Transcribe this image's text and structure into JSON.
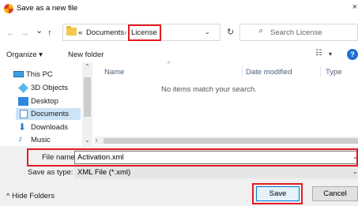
{
  "window": {
    "title": "Save as a new file",
    "close_glyph": "×"
  },
  "nav_buttons": {
    "back": "←",
    "forward": "→",
    "history": "⌄",
    "up": "↑"
  },
  "breadcrumb": {
    "overflow": "«",
    "parts": [
      "Documents",
      "License"
    ],
    "separator": "›"
  },
  "search": {
    "placeholder": "Search License"
  },
  "toolbar": {
    "organize_label": "Organize ▾",
    "new_folder_label": "New folder"
  },
  "nav_pane": {
    "items": [
      {
        "label": "This PC",
        "icon": "computer-icon"
      },
      {
        "label": "3D Objects",
        "icon": "cube-icon"
      },
      {
        "label": "Desktop",
        "icon": "desktop-icon"
      },
      {
        "label": "Documents",
        "icon": "documents-icon",
        "selected": true
      },
      {
        "label": "Downloads",
        "icon": "download-arrow-icon"
      },
      {
        "label": "Music",
        "icon": "music-note-icon"
      }
    ]
  },
  "file_list": {
    "columns": [
      "Name",
      "Date modified",
      "Type"
    ],
    "empty_message": "No items match your search."
  },
  "form": {
    "file_name_label": "File name:",
    "file_name_value": "Activation.xml",
    "save_type_label": "Save as type:",
    "save_type_value": "XML File (*.xml)"
  },
  "footer": {
    "hide_folders_label": "Hide Folders",
    "save_label": "Save",
    "cancel_label": "Cancel"
  },
  "highlight_color": "#e31c23"
}
